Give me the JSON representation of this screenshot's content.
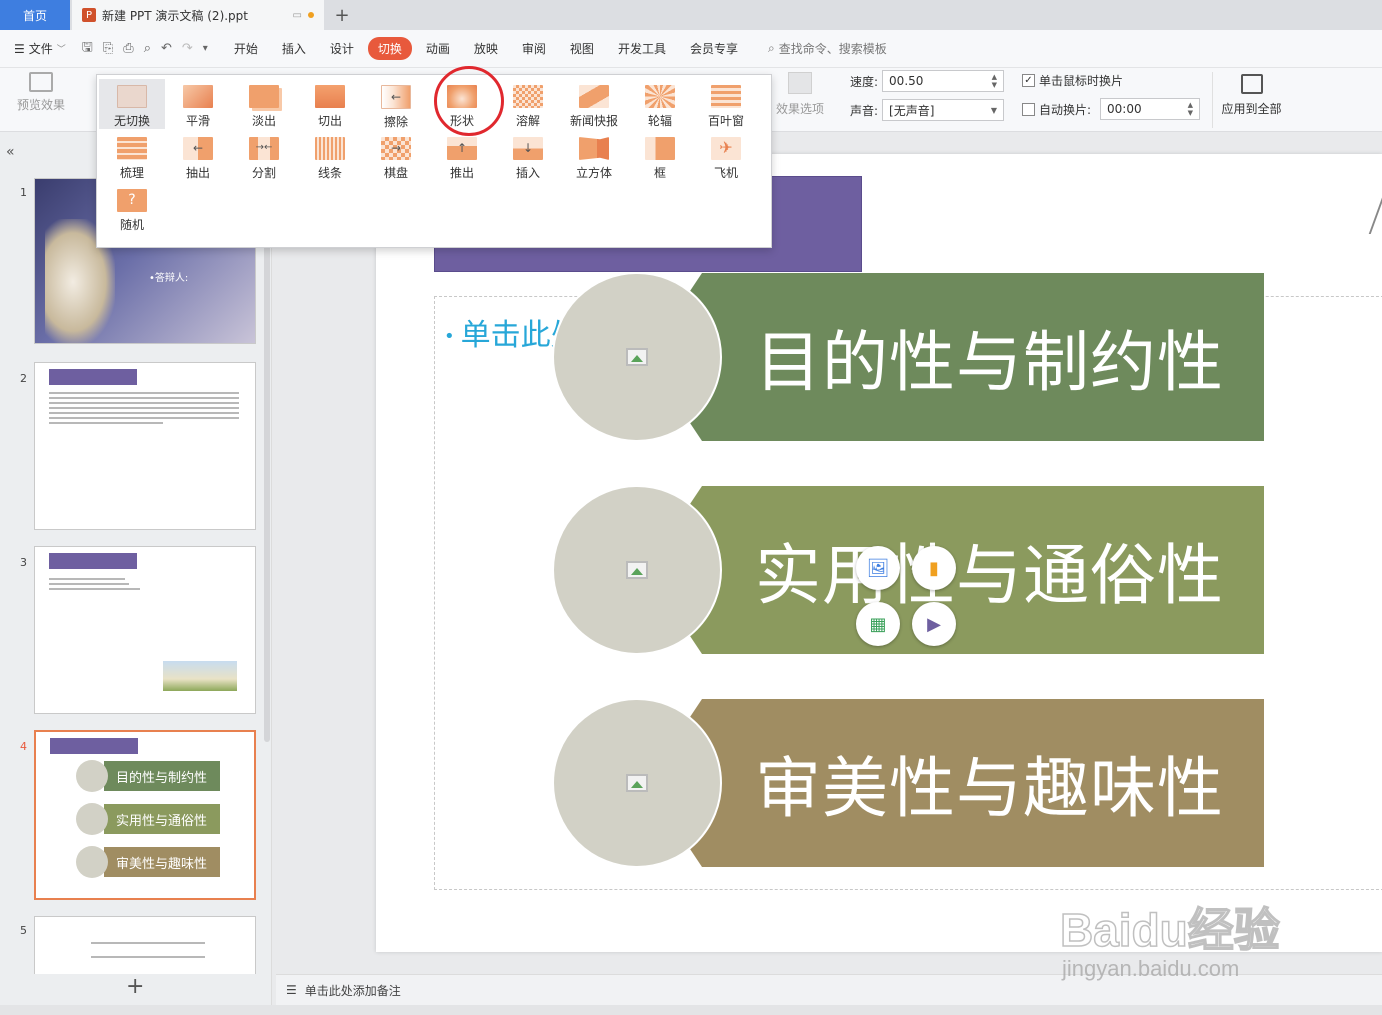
{
  "tabs": {
    "home": "首页",
    "doc_title": "新建 PPT 演示文稿 (2).ppt",
    "new_tab": "+"
  },
  "menu": {
    "file": "文件",
    "items": [
      "开始",
      "插入",
      "设计",
      "切换",
      "动画",
      "放映",
      "审阅",
      "视图",
      "开发工具",
      "会员专享"
    ],
    "active": "切换",
    "search": "查找命令、搜索模板"
  },
  "ribbon": {
    "preview": "预览效果",
    "effect_options": "效果选项",
    "speed_label": "速度:",
    "speed_value": "00.50",
    "sound_label": "声音:",
    "sound_value": "[无声音]",
    "click_advance": "单击鼠标时换片",
    "auto_advance": "自动换片:",
    "auto_value": "00:00",
    "apply_all": "应用到全部"
  },
  "gallery": {
    "items": [
      {
        "label": "无切换",
        "icon": "none-transition-icon"
      },
      {
        "label": "平滑",
        "icon": "morph-transition-icon"
      },
      {
        "label": "淡出",
        "icon": "fade-transition-icon"
      },
      {
        "label": "切出",
        "icon": "cut-transition-icon"
      },
      {
        "label": "擦除",
        "icon": "wipe-transition-icon"
      },
      {
        "label": "形状",
        "icon": "shape-transition-icon"
      },
      {
        "label": "溶解",
        "icon": "dissolve-transition-icon"
      },
      {
        "label": "新闻快报",
        "icon": "newsflash-transition-icon"
      },
      {
        "label": "轮辐",
        "icon": "wheel-transition-icon"
      },
      {
        "label": "百叶窗",
        "icon": "blinds-transition-icon"
      },
      {
        "label": "梳理",
        "icon": "comb-transition-icon"
      },
      {
        "label": "抽出",
        "icon": "pull-transition-icon"
      },
      {
        "label": "分割",
        "icon": "split-transition-icon"
      },
      {
        "label": "线条",
        "icon": "lines-transition-icon"
      },
      {
        "label": "棋盘",
        "icon": "checkerboard-transition-icon"
      },
      {
        "label": "推出",
        "icon": "push-transition-icon"
      },
      {
        "label": "插入",
        "icon": "cover-transition-icon"
      },
      {
        "label": "立方体",
        "icon": "cube-transition-icon"
      },
      {
        "label": "框",
        "icon": "box-transition-icon"
      },
      {
        "label": "飞机",
        "icon": "airplane-transition-icon"
      },
      {
        "label": "随机",
        "icon": "random-transition-icon"
      }
    ]
  },
  "thumbnails": {
    "numbers": [
      "1",
      "2",
      "3",
      "4",
      "5"
    ],
    "slide1_subtitle": "•答辩人:",
    "slide4_items": [
      "目的性与制约性",
      "实用性与通俗性",
      "审美性与趣味性"
    ]
  },
  "slide": {
    "placeholder": "单击此处添加文本",
    "bands": [
      {
        "text": "目的性与制约性",
        "color": "#6e8a5c"
      },
      {
        "text": "实用性与通俗性",
        "color": "#8b9a5e"
      },
      {
        "text": "审美性与趣味性",
        "color": "#a08d62"
      }
    ]
  },
  "notes": {
    "placeholder": "单击此处添加备注"
  },
  "watermark": {
    "brand": "Baidu经验",
    "url": "jingyan.baidu.com"
  },
  "colors": {
    "accent": "#e8593c",
    "home_tab": "#3e7ee0",
    "title_bar": "#6e5fa0",
    "placeholder_text": "#27a7d8"
  }
}
